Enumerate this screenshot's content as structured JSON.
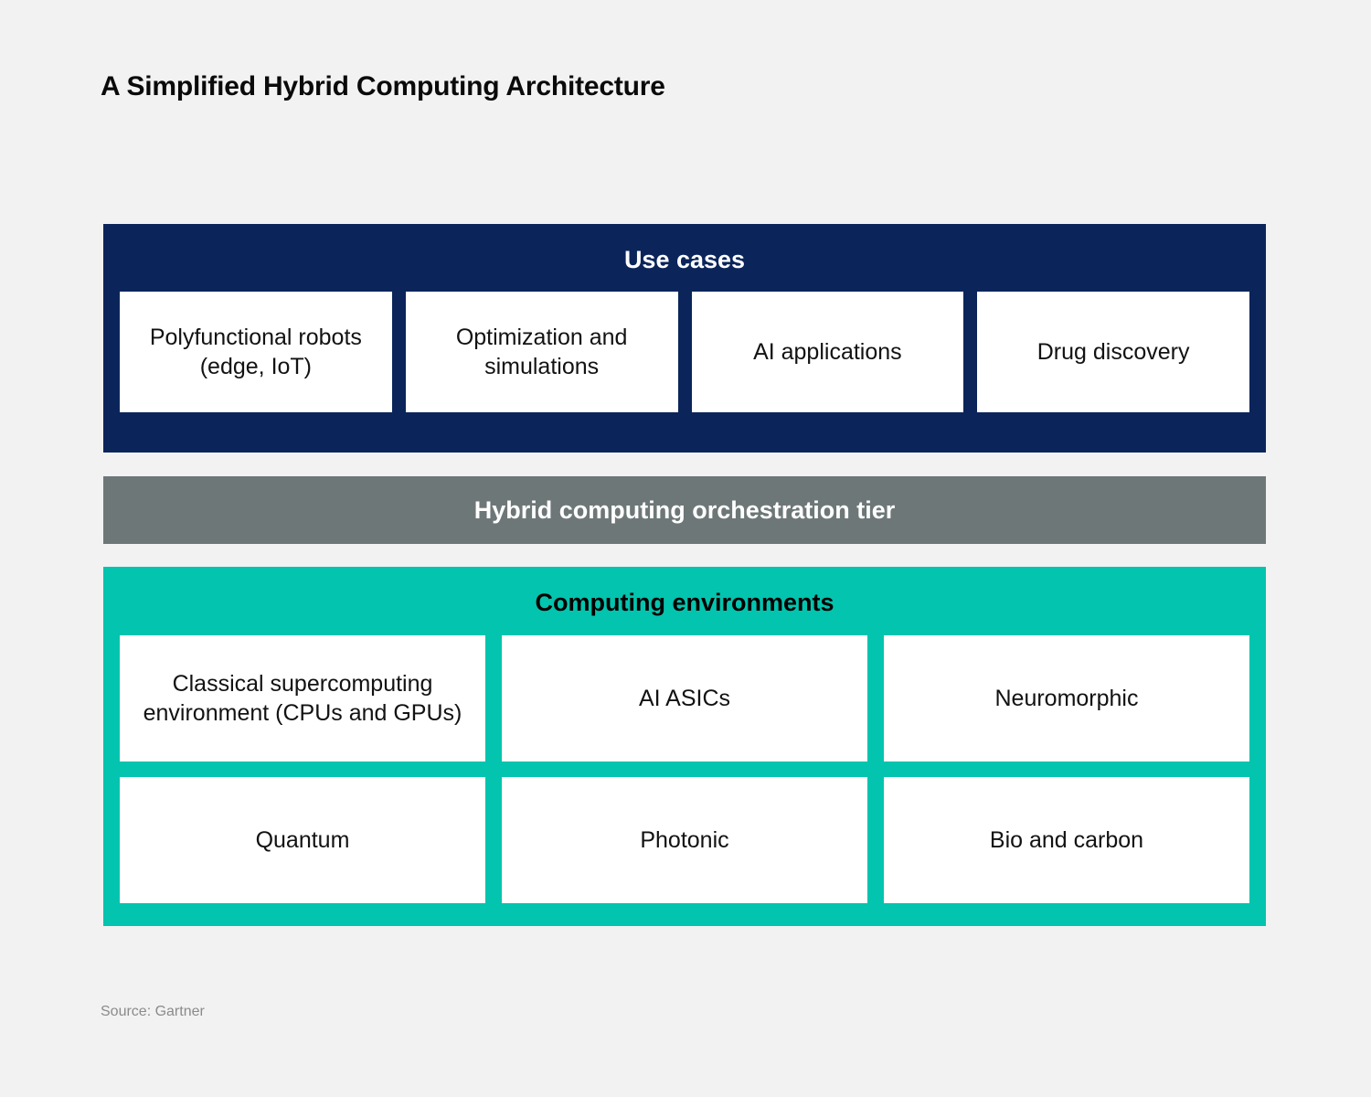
{
  "title": "A Simplified Hybrid Computing Architecture",
  "source": "Source: Gartner",
  "colors": {
    "background": "#f2f2f2",
    "use_cases_band": "#0b255b",
    "orchestration_band": "#6e7778",
    "environments_band": "#03c4ae",
    "card": "#ffffff",
    "title_text": "#0a0a0a",
    "source_text": "#8b8b8b"
  },
  "tiers": {
    "use_cases": {
      "heading": "Use cases",
      "cards": [
        "Polyfunctional robots (edge, IoT)",
        "Optimization and simulations",
        "AI applications",
        "Drug discovery"
      ]
    },
    "orchestration": {
      "heading": "Hybrid computing orchestration tier"
    },
    "environments": {
      "heading": "Computing environments",
      "row1": [
        "Classical supercomputing environment (CPUs and GPUs)",
        "AI ASICs",
        "Neuromorphic"
      ],
      "row2": [
        "Quantum",
        "Photonic",
        "Bio and carbon"
      ]
    }
  }
}
